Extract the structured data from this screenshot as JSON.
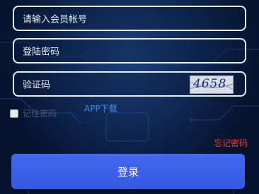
{
  "form": {
    "account_placeholder": "请输入会员帐号",
    "password_placeholder": "登陆密码",
    "captcha_placeholder": "验证码",
    "captcha_code": "4658",
    "remember_label": "记住密码",
    "app_download": "APP下载",
    "forgot_password": "忘记密码",
    "login_button": "登录"
  },
  "colors": {
    "background": "#0b1f3f",
    "field_border": "#e9eef6",
    "link_blue": "#3d8ee6",
    "forgot_red": "#e8433d",
    "button_blue": "#3d60e8"
  }
}
